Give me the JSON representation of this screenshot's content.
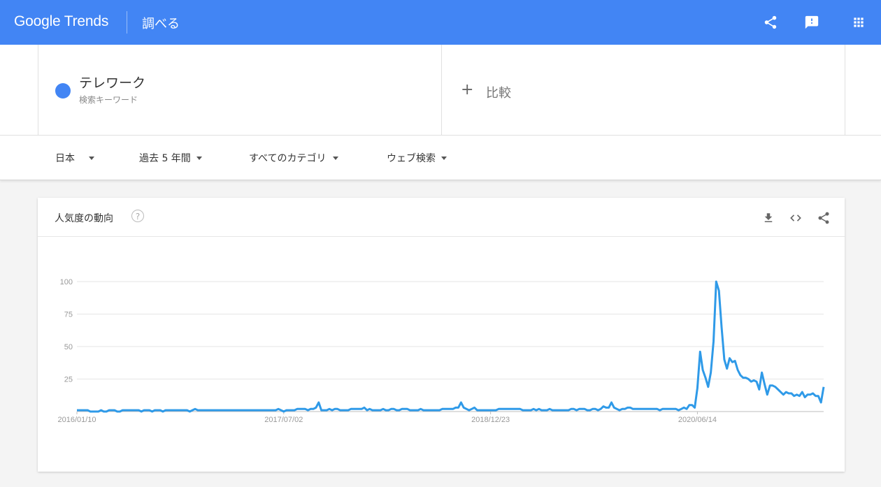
{
  "header": {
    "logo": "Google Trends",
    "page_title": "調べる",
    "background": "#4285f4"
  },
  "icons": {
    "share": "share-icon",
    "feedback": "feedback-icon",
    "apps": "apps-grid-icon",
    "download": "download-icon",
    "embed": "embed-code-icon",
    "card_share": "share-icon",
    "help": "help-icon"
  },
  "search_term": {
    "name": "テレワーク",
    "subtitle": "検索キーワード",
    "color": "#4285f4"
  },
  "compare": {
    "plus": "+",
    "label": "比較"
  },
  "filters": {
    "region": "日本",
    "time": "過去 5 年間",
    "category": "すべてのカテゴリ",
    "search_type": "ウェブ検索"
  },
  "card": {
    "title": "人気度の動向",
    "help": "?"
  },
  "chart_data": {
    "type": "line",
    "title": "人気度の動向",
    "xlabel": "",
    "ylabel": "",
    "ylim": [
      0,
      100
    ],
    "y_ticks": [
      100,
      75,
      50,
      25
    ],
    "x_tick_labels": [
      "2016/01/10",
      "2017/07/02",
      "2018/12/23",
      "2020/06/14"
    ],
    "x_tick_indices": [
      0,
      77,
      154,
      231
    ],
    "grid": true,
    "line_color": "#2f9ae8",
    "series": [
      {
        "values": [
          1,
          1,
          1,
          1,
          1,
          0,
          0,
          0,
          0,
          1,
          0,
          0,
          1,
          1,
          1,
          0,
          0,
          1,
          1,
          1,
          1,
          1,
          1,
          1,
          0,
          1,
          1,
          1,
          0,
          1,
          1,
          1,
          0,
          1,
          1,
          1,
          1,
          1,
          1,
          1,
          1,
          1,
          0,
          1,
          2,
          1,
          1,
          1,
          1,
          1,
          1,
          1,
          1,
          1,
          1,
          1,
          1,
          1,
          1,
          1,
          1,
          1,
          1,
          1,
          1,
          1,
          1,
          1,
          1,
          1,
          1,
          1,
          1,
          1,
          1,
          2,
          1,
          0,
          1,
          1,
          1,
          1,
          2,
          2,
          2,
          2,
          1,
          2,
          2,
          3,
          7,
          1,
          1,
          1,
          2,
          1,
          2,
          2,
          1,
          1,
          1,
          1,
          2,
          2,
          2,
          2,
          2,
          3,
          1,
          2,
          1,
          1,
          1,
          1,
          2,
          1,
          1,
          2,
          2,
          1,
          1,
          2,
          2,
          2,
          1,
          1,
          1,
          1,
          2,
          1,
          1,
          1,
          1,
          1,
          1,
          1,
          2,
          2,
          2,
          2,
          2,
          3,
          3,
          7,
          3,
          2,
          1,
          2,
          3,
          1,
          1,
          1,
          1,
          1,
          1,
          1,
          1,
          2,
          2,
          2,
          2,
          2,
          2,
          2,
          2,
          2,
          1,
          1,
          1,
          1,
          2,
          1,
          2,
          1,
          1,
          1,
          2,
          1,
          1,
          1,
          1,
          1,
          1,
          1,
          2,
          2,
          1,
          2,
          2,
          2,
          1,
          1,
          2,
          2,
          1,
          2,
          4,
          3,
          3,
          7,
          3,
          2,
          1,
          2,
          2,
          3,
          3,
          2,
          2,
          2,
          2,
          2,
          2,
          2,
          2,
          2,
          2,
          1,
          2,
          2,
          2,
          2,
          2,
          2,
          1,
          2,
          3,
          2,
          5,
          5,
          3,
          18,
          46,
          32,
          26,
          19,
          30,
          54,
          100,
          93,
          65,
          40,
          33,
          41,
          38,
          39,
          32,
          28,
          26,
          26,
          25,
          23,
          24,
          23,
          17,
          30,
          21,
          13,
          20,
          20,
          19,
          17,
          15,
          13,
          15,
          14,
          14,
          12,
          13,
          12,
          15,
          11,
          13,
          13,
          14,
          12,
          12,
          7,
          19
        ]
      }
    ]
  }
}
